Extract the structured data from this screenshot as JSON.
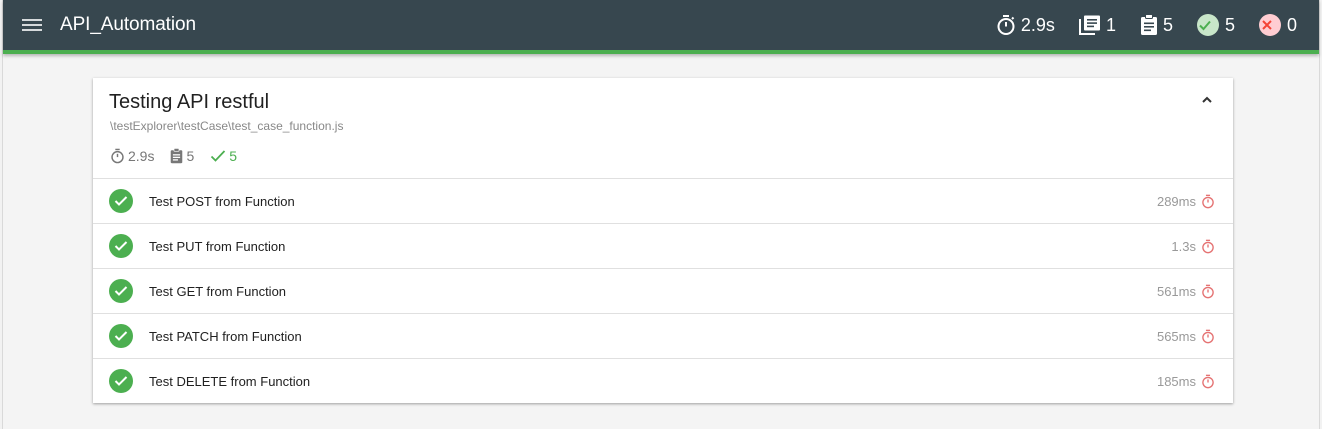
{
  "header": {
    "app_title": "API_Automation",
    "stats": {
      "duration": "2.9s",
      "suites": "1",
      "tests": "5",
      "passed": "5",
      "failed": "0"
    }
  },
  "suite": {
    "title": "Testing API restful",
    "path": "\\testExplorer\\testCase\\test_case_function.js",
    "duration": "2.9s",
    "tests": "5",
    "passed": "5"
  },
  "tests": [
    {
      "name": "Test POST from Function",
      "duration": "289ms",
      "status": "passed"
    },
    {
      "name": "Test PUT from Function",
      "duration": "1.3s",
      "status": "passed"
    },
    {
      "name": "Test GET from Function",
      "duration": "561ms",
      "status": "passed"
    },
    {
      "name": "Test PATCH from Function",
      "duration": "565ms",
      "status": "passed"
    },
    {
      "name": "Test DELETE from Function",
      "duration": "185ms",
      "status": "passed"
    }
  ],
  "colors": {
    "header_bg": "#37474f",
    "accent_pass": "#4caf50",
    "slow_timer": "#e57373"
  }
}
